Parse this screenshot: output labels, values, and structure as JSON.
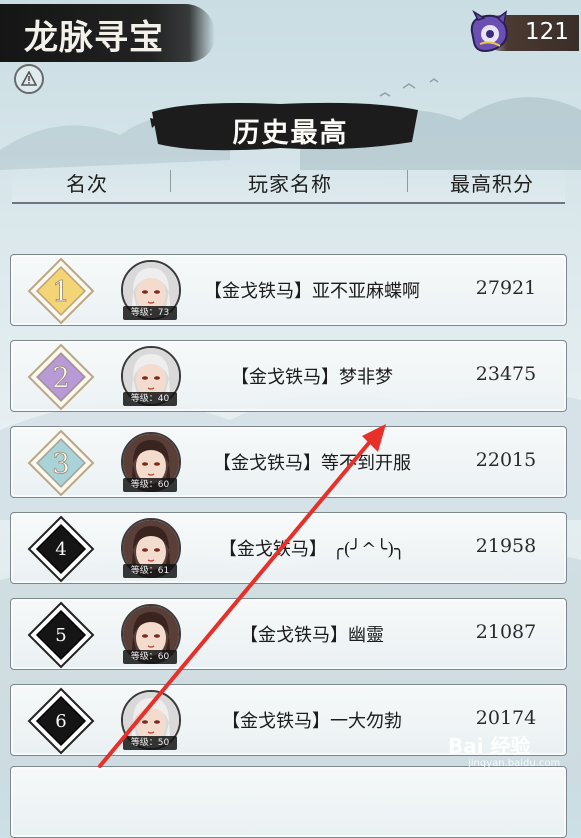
{
  "game": {
    "title": "龙脉寻宝",
    "coin_count": "121",
    "coin_icon": "purple-spirit-icon",
    "warn_icon": "exclamation-icon"
  },
  "section": {
    "title": "历史最高"
  },
  "columns": {
    "rank": "名次",
    "player": "玩家名称",
    "score": "最高积分"
  },
  "rows": [
    {
      "rank": "1",
      "badge": "gold",
      "name": "【金戈铁马】亚不亚麻蝶啊",
      "level": "等级：73",
      "score": "27921",
      "hair": "white"
    },
    {
      "rank": "2",
      "badge": "purple",
      "name": "【金戈铁马】梦非梦",
      "level": "等级：40",
      "score": "23475",
      "hair": "white"
    },
    {
      "rank": "3",
      "badge": "teal",
      "name": "【金戈铁马】等不到开服",
      "level": "等级：60",
      "score": "22015",
      "hair": "dark"
    },
    {
      "rank": "4",
      "badge": "black",
      "name": "【金戈铁马】 ╭(╯^╰)╮",
      "level": "等级：61",
      "score": "21958",
      "hair": "dark"
    },
    {
      "rank": "5",
      "badge": "black",
      "name": "【金戈铁马】幽靈",
      "level": "等级：60",
      "score": "21087",
      "hair": "dark"
    },
    {
      "rank": "6",
      "badge": "black",
      "name": "【金戈铁马】一大勿勃",
      "level": "等级：50",
      "score": "20174",
      "hair": "white"
    }
  ],
  "colors": {
    "gold": "#f3d477",
    "purple": "#b79ad6",
    "teal": "#a9d3d8",
    "black": "#151515",
    "arrow": "#e8302a"
  },
  "watermark": {
    "brand": "Bai 经验",
    "url": "jingyan.baidu.com"
  }
}
